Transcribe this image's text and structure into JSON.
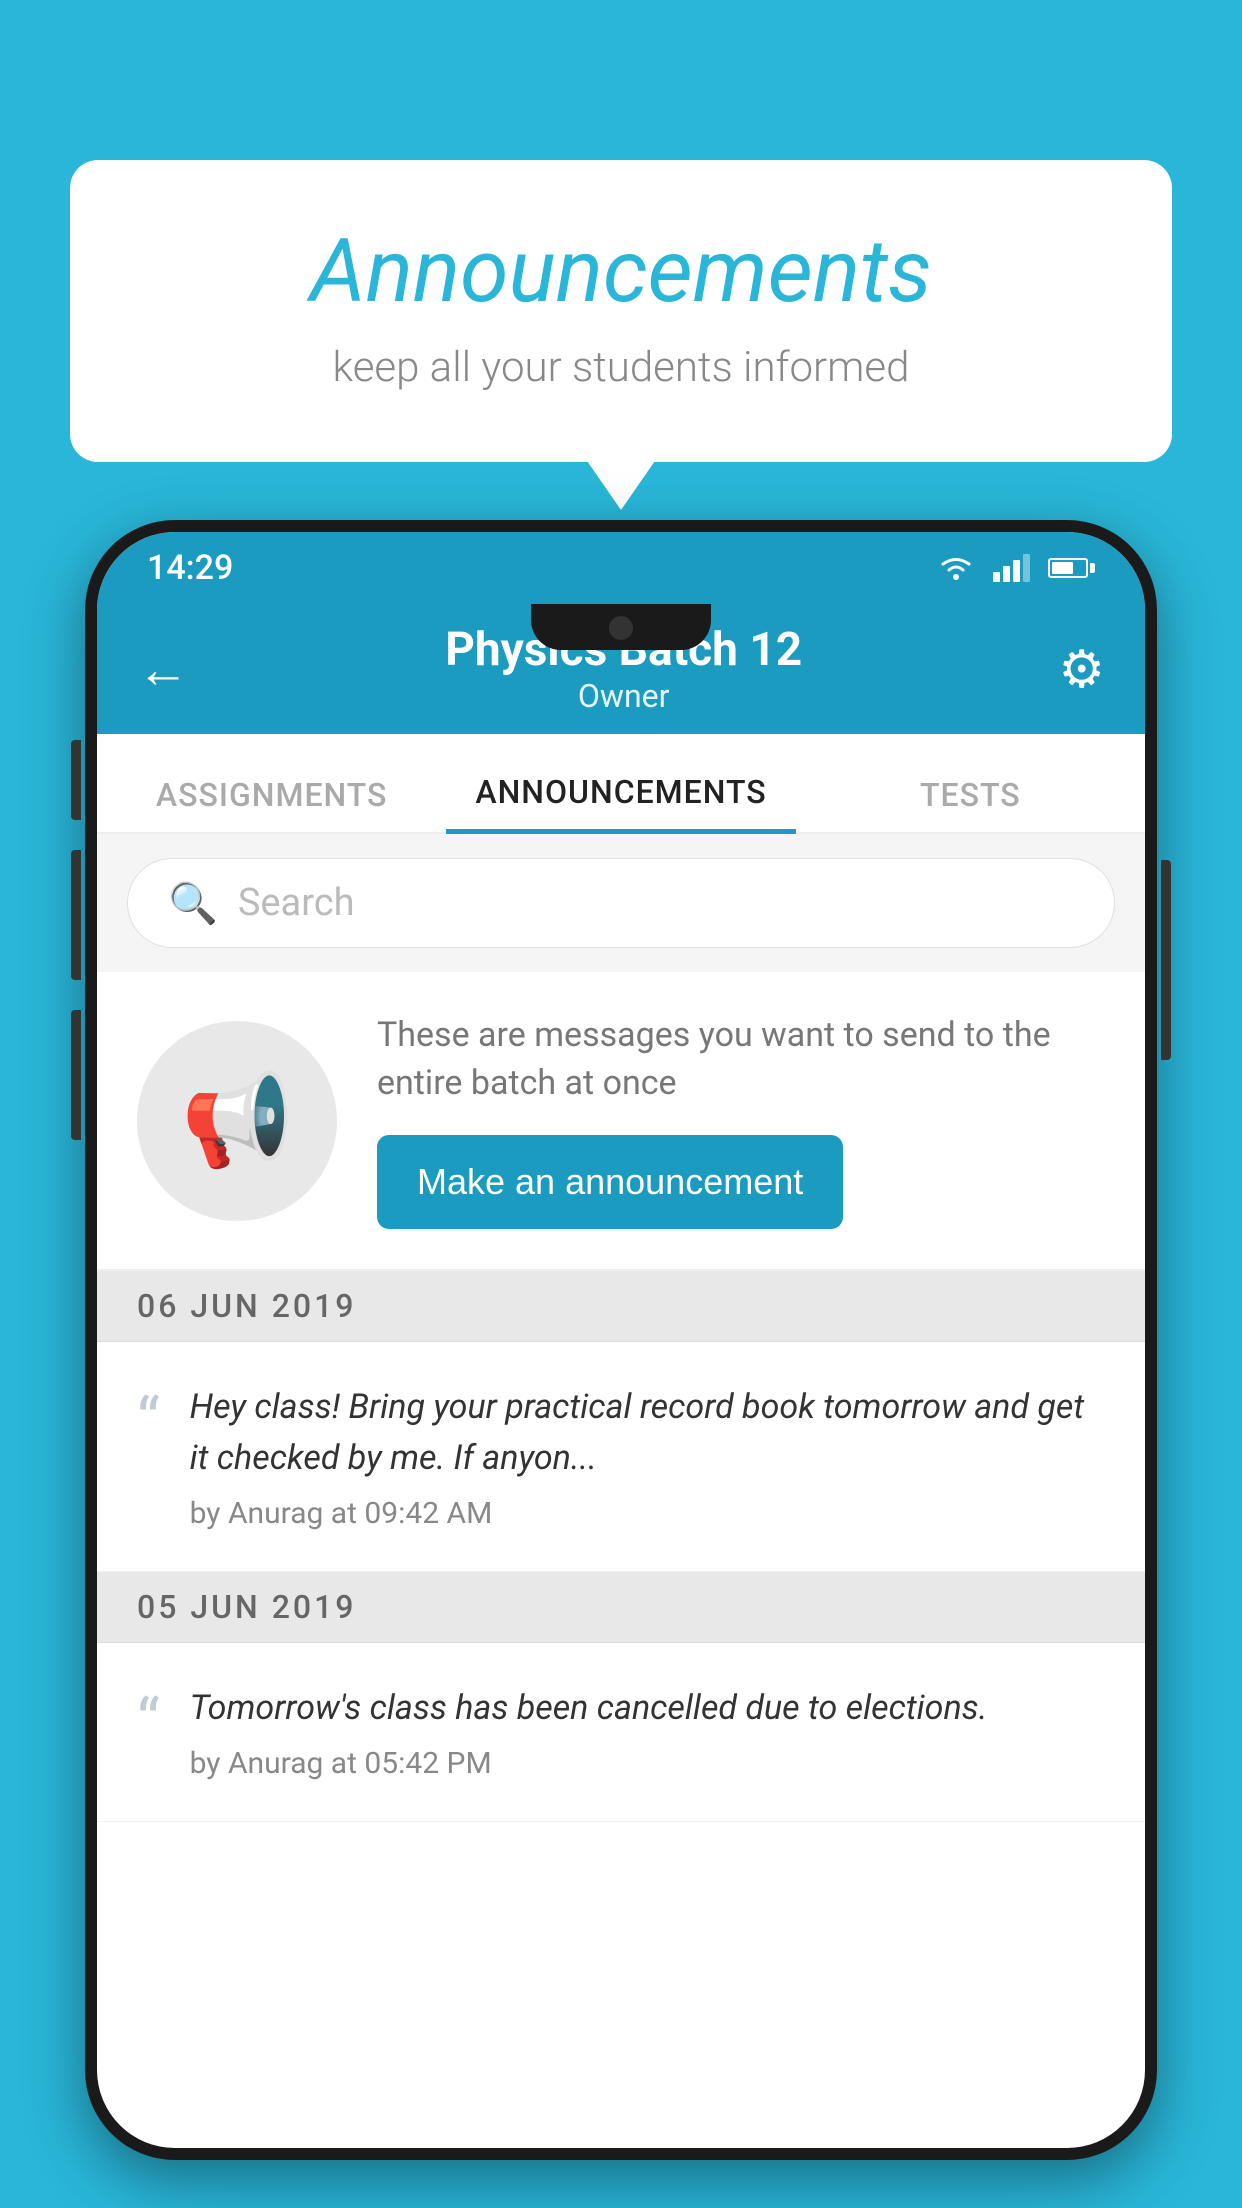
{
  "bubble": {
    "title": "Announcements",
    "subtitle": "keep all your students informed"
  },
  "status_bar": {
    "time": "14:29"
  },
  "app_header": {
    "title": "Physics Batch 12",
    "subtitle": "Owner"
  },
  "tabs": [
    {
      "label": "ASSIGNMENTS",
      "active": false
    },
    {
      "label": "ANNOUNCEMENTS",
      "active": true
    },
    {
      "label": "TESTS",
      "active": false
    }
  ],
  "search": {
    "placeholder": "Search"
  },
  "promo": {
    "description": "These are messages you want to send to the entire batch at once",
    "button_label": "Make an announcement"
  },
  "announcements": [
    {
      "date": "06  JUN  2019",
      "text": "Hey class! Bring your practical record book tomorrow and get it checked by me. If anyon...",
      "meta": "by Anurag at 09:42 AM"
    },
    {
      "date": "05  JUN  2019",
      "text": "Tomorrow's class has been cancelled due to elections.",
      "meta": "by Anurag at 05:42 PM"
    }
  ],
  "colors": {
    "primary": "#1a9bbf",
    "background": "#29b6d8"
  }
}
